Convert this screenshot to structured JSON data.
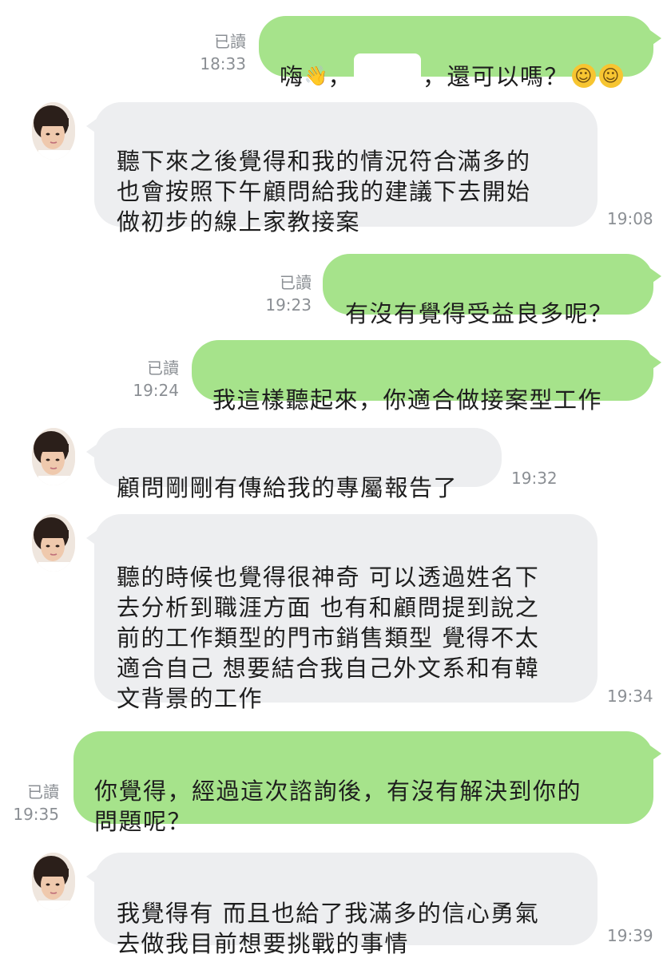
{
  "conversation": {
    "messages": [
      {
        "direction": "outgoing",
        "text_before": "嗨",
        "wave_emoji": "👋",
        "comma": "，",
        "text_after": "，還可以嗎？",
        "smiley": "☺",
        "read_label": "已讀",
        "time": "18:33"
      },
      {
        "direction": "incoming",
        "text": "聽下來之後覺得和我的情況符合滿多的\n也會按照下午顧問給我的建議下去開始\n做初步的線上家教接案",
        "time": "19:08"
      },
      {
        "direction": "outgoing",
        "text": "有沒有覺得受益良多呢？",
        "read_label": "已讀",
        "time": "19:23"
      },
      {
        "direction": "outgoing",
        "text": "我這樣聽起來，你適合做接案型工作",
        "read_label": "已讀",
        "time": "19:24"
      },
      {
        "direction": "incoming",
        "text": "顧問剛剛有傳給我的專屬報告了",
        "time": "19:32"
      },
      {
        "direction": "incoming",
        "text": "聽的時候也覺得很神奇 可以透過姓名下\n去分析到職涯方面 也有和顧問提到說之\n前的工作類型的門市銷售類型 覺得不太\n適合自己 想要結合我自己外文系和有韓\n文背景的工作",
        "time": "19:34"
      },
      {
        "direction": "outgoing",
        "text": "你覺得，經過這次諮詢後，有沒有解決到你的\n問題呢？",
        "read_label": "已讀",
        "time": "19:35"
      },
      {
        "direction": "incoming",
        "text": "我覺得有 而且也給了我滿多的信心勇氣\n去做我目前想要挑戰的事情",
        "time": "19:39"
      }
    ]
  },
  "colors": {
    "outgoing_bubble": "#a6e38b",
    "incoming_bubble": "#edeef0",
    "meta_text": "#8b8f94",
    "background": "#ffffff"
  },
  "icons": {
    "avatar": "contact-avatar",
    "wave": "waving-hand-emoji",
    "smile": "smiling-face-emoji"
  }
}
